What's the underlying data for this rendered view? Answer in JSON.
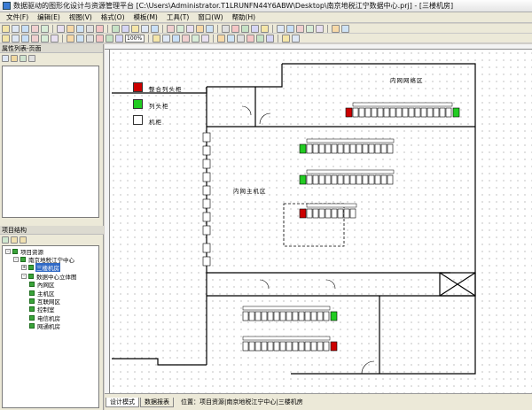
{
  "window": {
    "title": "数据驱动的图形化设计与资源管理平台 [C:\\Users\\Administrator.T1LRUNFN44Y6ABW\\Desktop\\南京地税江宁数据中心.prj] - [三楼机房]"
  },
  "menu": [
    "文件(F)",
    "编辑(E)",
    "视图(V)",
    "格式(O)",
    "模板(M)",
    "工具(T)",
    "窗口(W)",
    "帮助(H)"
  ],
  "toolbar": {
    "zoom": "100%"
  },
  "property_panel": {
    "title": "属性列表-页面"
  },
  "tree_panel": {
    "title": "项目结构",
    "nodes": [
      {
        "label": "项目资源",
        "depth": 0,
        "expander": "-",
        "checked": true
      },
      {
        "label": "南京地税江宁中心",
        "depth": 1,
        "expander": "-",
        "checked": true
      },
      {
        "label": "三楼机房",
        "depth": 2,
        "expander": "+",
        "checked": true,
        "selected": true
      },
      {
        "label": "数据中心立体图",
        "depth": 2,
        "expander": "-",
        "checked": true
      },
      {
        "label": "內网区",
        "depth": 3,
        "expander": "",
        "checked": true
      },
      {
        "label": "主机区",
        "depth": 3,
        "expander": "",
        "checked": true
      },
      {
        "label": "互联网区",
        "depth": 3,
        "expander": "",
        "checked": true
      },
      {
        "label": "控制室",
        "depth": 3,
        "expander": "",
        "checked": true
      },
      {
        "label": "电信机房",
        "depth": 3,
        "expander": "",
        "checked": true
      },
      {
        "label": "网通机房",
        "depth": 3,
        "expander": "",
        "checked": true
      }
    ]
  },
  "legend": [
    {
      "label": "整合列头柜",
      "color": "#cc0000"
    },
    {
      "label": "列头柜",
      "color": "#22cc22"
    },
    {
      "label": "机柜",
      "color": "#ffffff"
    }
  ],
  "rooms": {
    "network_area": "内网网络区",
    "host_area": "内网主机区"
  },
  "tabs": [
    "设计模式",
    "数据报表"
  ],
  "status": {
    "location": "位置：项目资源|南京地税江宁中心|三楼机房"
  },
  "colors": {
    "title_bg": "#e8e8e8",
    "selection": "#316ac5",
    "check_green": "#3aa43a"
  }
}
